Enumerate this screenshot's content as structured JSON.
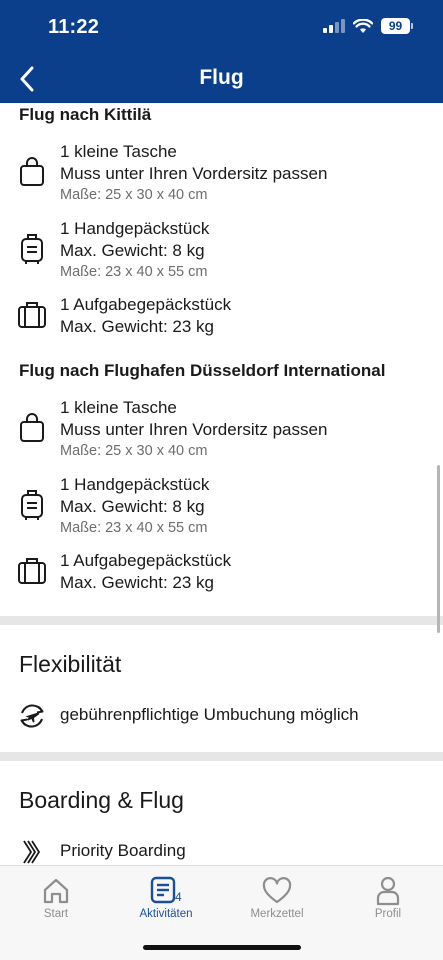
{
  "status_bar": {
    "time": "11:22",
    "battery": "99"
  },
  "header": {
    "title": "Flug"
  },
  "flights": [
    {
      "title": "Flug nach Kittilä",
      "bags": [
        {
          "icon": "handbag-icon",
          "name": "1 kleine Tasche",
          "detail": "Muss unter Ihren Vordersitz passen",
          "size": "Maße: 25 x 30 x 40 cm"
        },
        {
          "icon": "cabin-luggage-icon",
          "name": "1 Handgepäckstück",
          "detail": "Max. Gewicht: 8 kg",
          "size": "Maße: 23 x 40 x 55 cm"
        },
        {
          "icon": "checked-luggage-icon",
          "name": "1 Aufgabegepäckstück",
          "detail": "Max. Gewicht: 23 kg"
        }
      ]
    },
    {
      "title": "Flug nach Flughafen Düsseldorf International",
      "bags": [
        {
          "icon": "handbag-icon",
          "name": "1 kleine Tasche",
          "detail": "Muss unter Ihren Vordersitz passen",
          "size": "Maße: 25 x 30 x 40 cm"
        },
        {
          "icon": "cabin-luggage-icon",
          "name": "1 Handgepäckstück",
          "detail": "Max. Gewicht: 8 kg",
          "size": "Maße: 23 x 40 x 55 cm"
        },
        {
          "icon": "checked-luggage-icon",
          "name": "1 Aufgabegepäckstück",
          "detail": "Max. Gewicht: 23 kg"
        }
      ]
    }
  ],
  "flexibility": {
    "title": "Flexibilität",
    "item": "gebührenpflichtige Umbuchung möglich",
    "icon": "rebooking-icon"
  },
  "boarding": {
    "title": "Boarding & Flug",
    "item": "Priority Boarding",
    "icon": "priority-chevrons-icon"
  },
  "tabs": [
    {
      "label": "Start",
      "icon": "home-icon",
      "active": false
    },
    {
      "label": "Aktivitäten",
      "icon": "activities-icon",
      "badge": "4",
      "active": true
    },
    {
      "label": "Merkzettel",
      "icon": "heart-icon",
      "active": false
    },
    {
      "label": "Profil",
      "icon": "profile-icon",
      "active": false
    }
  ],
  "colors": {
    "header": "#0b3f8c",
    "active_tab": "#1b4f9c",
    "inactive_tab": "#8e8e8e"
  }
}
